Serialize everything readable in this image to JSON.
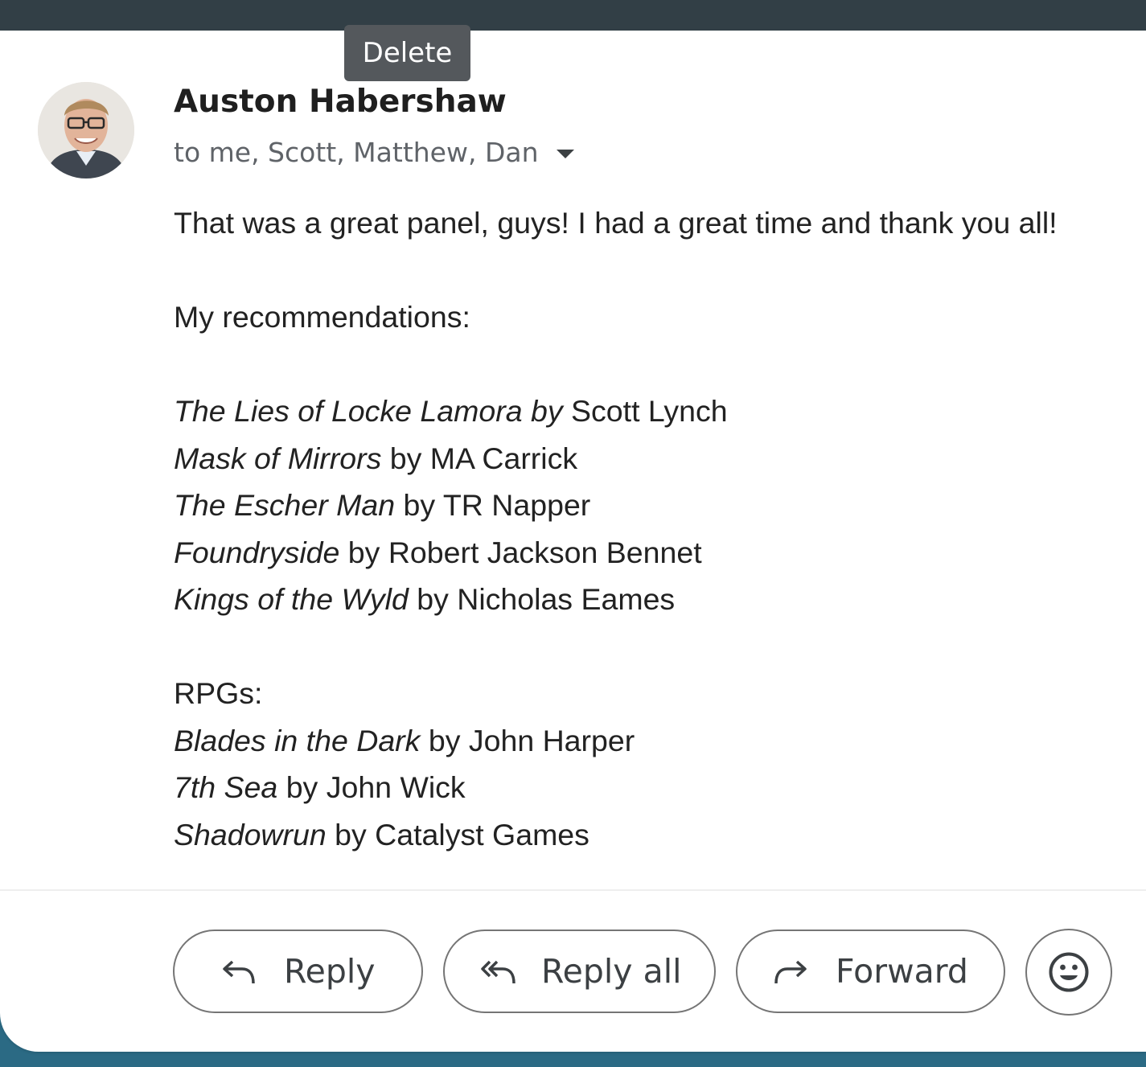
{
  "tooltip": {
    "text": "Delete"
  },
  "sender": {
    "name": "Auston Habershaw",
    "recipients": "to me, Scott, Matthew, Dan",
    "avatar_icon": "sender-avatar-photo"
  },
  "message": {
    "greeting": "That was a great panel, guys! I had a great time and thank you all!",
    "recommendations_heading": "My recommendations:",
    "books": [
      {
        "title": "The Lies of Locke Lamora by ",
        "author": "Scott Lynch"
      },
      {
        "title": "Mask of Mirrors",
        "author": " by MA Carrick"
      },
      {
        "title": "The Escher Man",
        "author": " by TR Napper"
      },
      {
        "title": "Foundryside",
        "author": " by Robert Jackson Bennet"
      },
      {
        "title": "Kings of the Wyld",
        "author": " by Nicholas Eames"
      }
    ],
    "rpgs_heading": "RPGs:",
    "rpgs": [
      {
        "title": "Blades in the Dark",
        "author": " by John Harper"
      },
      {
        "title": "7th Sea",
        "author": " by John Wick"
      },
      {
        "title": "Shadowrun",
        "author": " by Catalyst Games"
      }
    ]
  },
  "actions": {
    "reply_label": "Reply",
    "reply_all_label": "Reply all",
    "forward_label": "Forward",
    "emoji_icon": "emoji-react-icon"
  },
  "colors": {
    "top_bar": "#323f46",
    "page_bottom": "#2b6a84",
    "tooltip_bg": "#54585c",
    "button_border": "#757575"
  }
}
